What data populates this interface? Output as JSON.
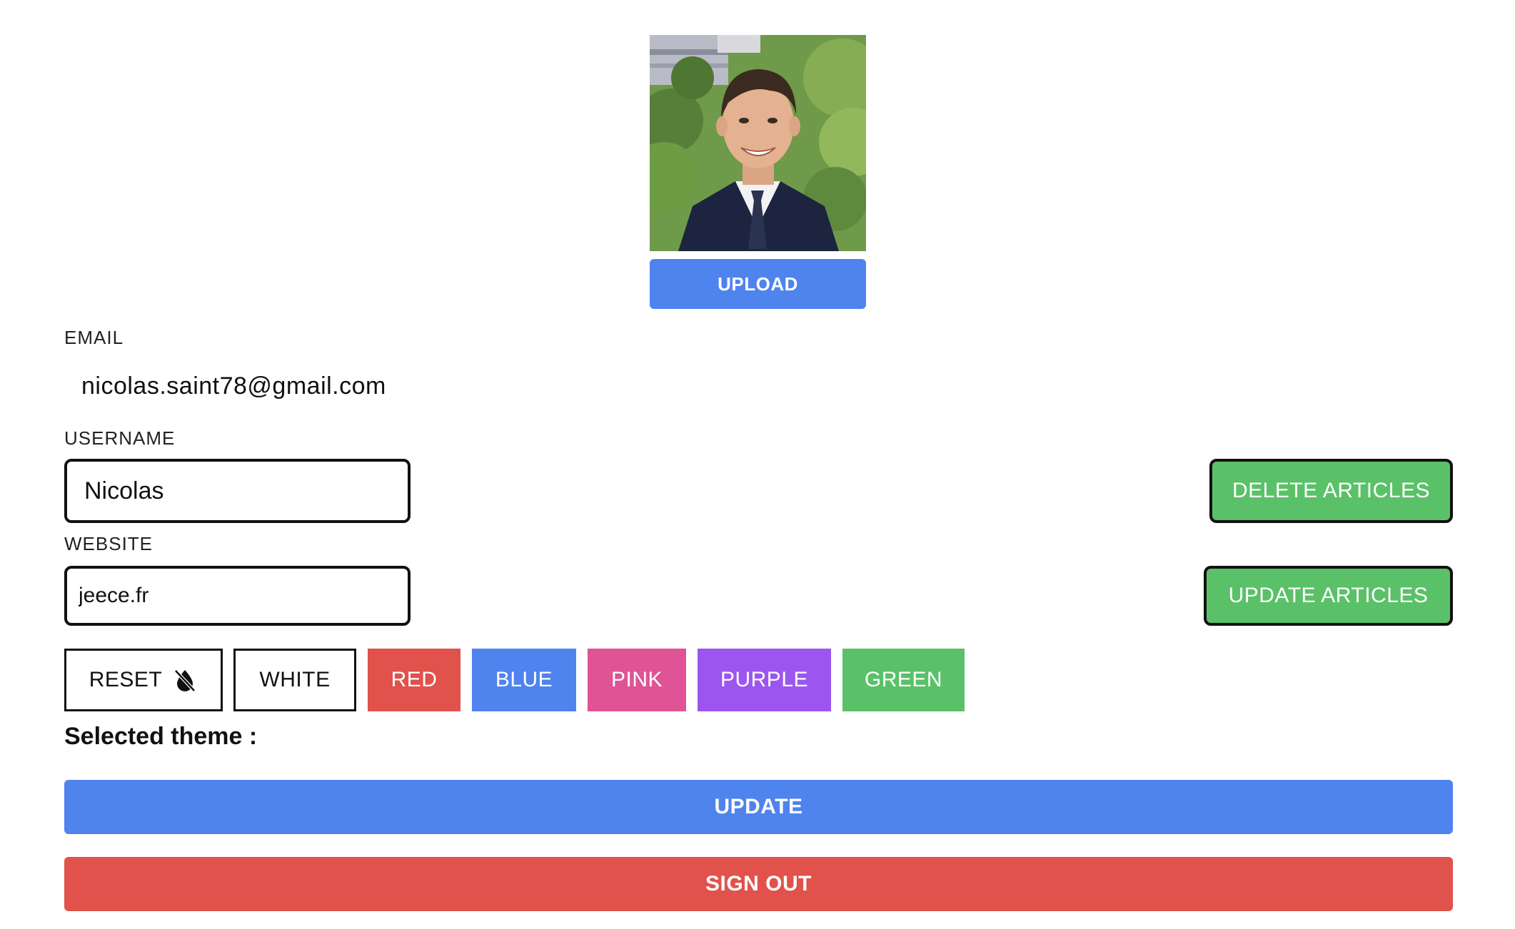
{
  "profile": {
    "upload_label": "UPLOAD"
  },
  "email": {
    "label": "EMAIL",
    "value": "nicolas.saint78@gmail.com"
  },
  "username": {
    "label": "USERNAME",
    "value": "Nicolas"
  },
  "website": {
    "label": "WEBSITE",
    "value": "jeece.fr"
  },
  "articles": {
    "delete_label": "DELETE ARTICLES",
    "update_label": "UPDATE ARTICLES"
  },
  "themes": {
    "reset_label": "RESET",
    "reset_icon": "no-drop-icon",
    "options": [
      "WHITE",
      "RED",
      "BLUE",
      "PINK",
      "PURPLE",
      "GREEN"
    ],
    "colors": {
      "RED": "#e0524b",
      "BLUE": "#4f83ee",
      "PINK": "#de5495",
      "PURPLE": "#9c56ef",
      "GREEN": "#5ac168"
    },
    "selected_label": "Selected theme :"
  },
  "actions": {
    "update_label": "UPDATE",
    "signout_label": "SIGN OUT"
  }
}
